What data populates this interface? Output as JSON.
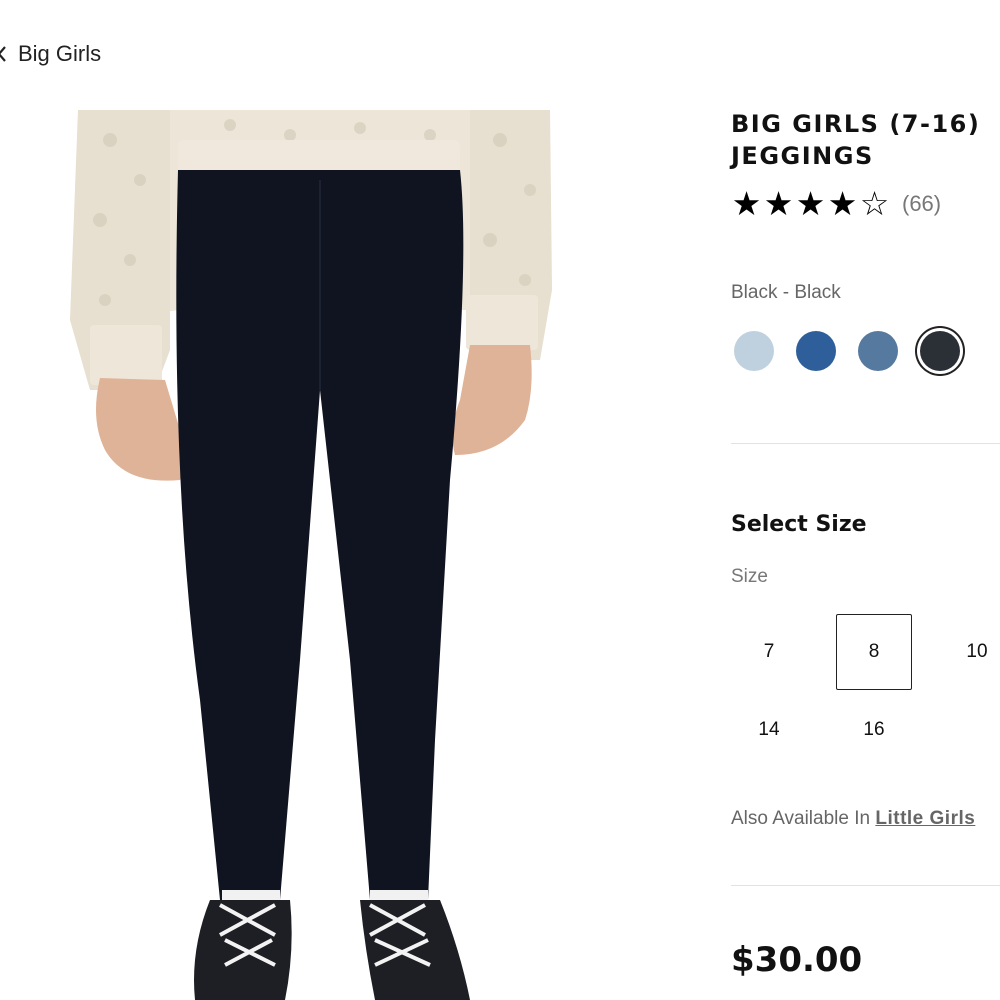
{
  "breadcrumb": {
    "label": "Big Girls"
  },
  "product": {
    "title_line1": "BIG GIRLS (7-16)",
    "title_line2": "JEGGINGS",
    "rating": {
      "stars": 4,
      "max": 5,
      "review_count_text": "(66)"
    },
    "color": {
      "selected_label": "Black - Black",
      "swatches": [
        {
          "name": "light-wash",
          "hex": "#bfd1de"
        },
        {
          "name": "medium-blue",
          "hex": "#2e5f9a"
        },
        {
          "name": "slate-blue",
          "hex": "#56799f"
        },
        {
          "name": "black",
          "hex": "#2b2f36",
          "selected": true
        }
      ]
    },
    "size": {
      "heading": "Select Size",
      "label": "Size",
      "options": [
        "7",
        "8",
        "10",
        "14",
        "16"
      ],
      "selected": "8"
    },
    "also_available": {
      "prefix": "Also Available In",
      "link": "Little Girls"
    },
    "price": "$30.00"
  },
  "colors": {
    "sweater": "#ece5d8",
    "cuff": "#eee5da",
    "leggings": "#101420",
    "skin": "#e0b59a",
    "shoe": "#1d1f24"
  },
  "icons": {
    "back": "chevron-left-icon",
    "star_full": "★",
    "star_empty": "☆"
  }
}
